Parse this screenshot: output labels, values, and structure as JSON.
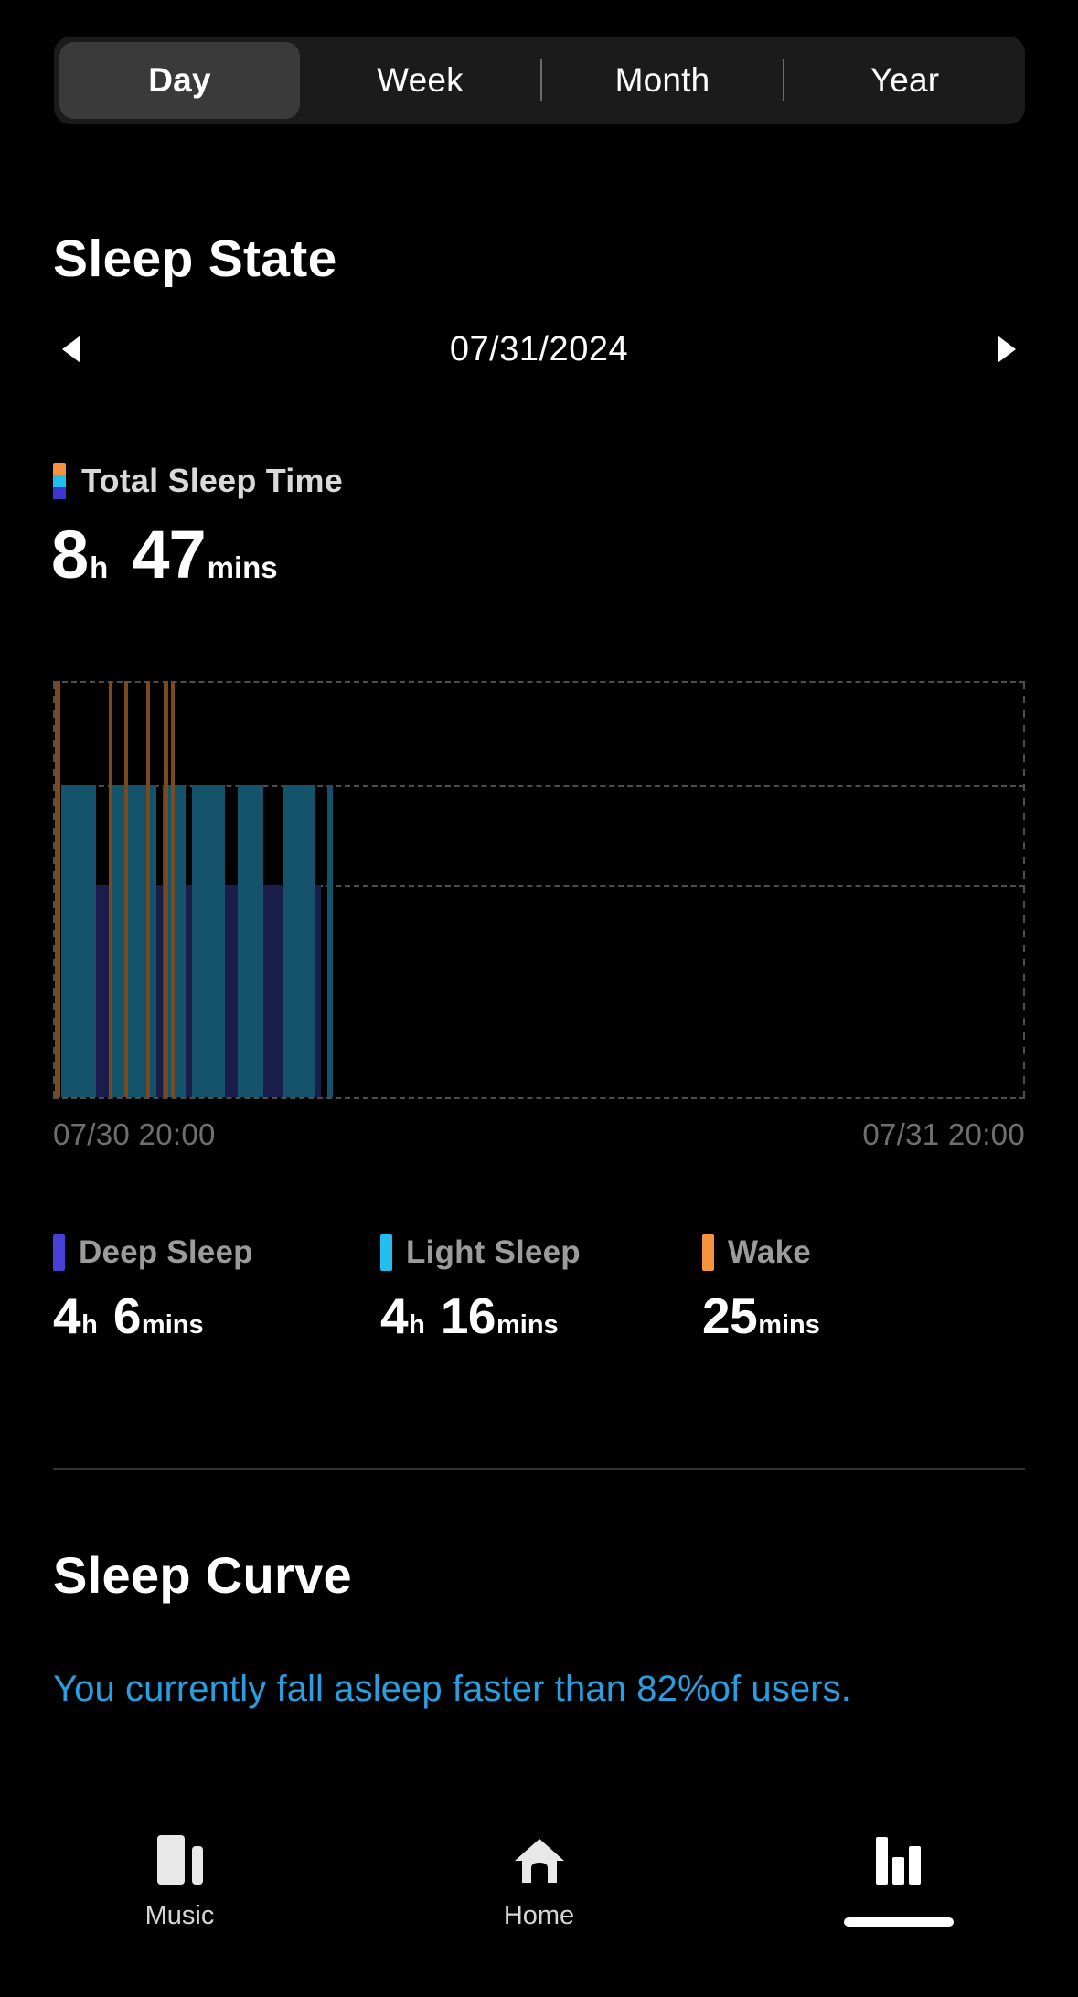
{
  "period_tabs": {
    "items": [
      {
        "label": "Day",
        "active": true
      },
      {
        "label": "Week",
        "active": false
      },
      {
        "label": "Month",
        "active": false
      },
      {
        "label": "Year",
        "active": false
      }
    ]
  },
  "page_title": "Sleep State",
  "date_nav": {
    "prev_icon": "triangle-left-icon",
    "next_icon": "triangle-right-icon",
    "date": "07/31/2024"
  },
  "total_sleep": {
    "label": "Total Sleep Time",
    "hours": "8",
    "hours_unit": "h",
    "minutes": "47",
    "minutes_unit": "mins",
    "swatch_colors": [
      "#F5933F",
      "#22BEF0",
      "#3C35CE"
    ]
  },
  "chart_axis": {
    "start": "07/30 20:00",
    "end": "07/31 20:00"
  },
  "legend": [
    {
      "name": "Deep Sleep",
      "color": "#4940d6",
      "hours": "4",
      "hours_unit": "h",
      "minutes": "6",
      "minutes_unit": "mins"
    },
    {
      "name": "Light Sleep",
      "color": "#22BEF0",
      "hours": "4",
      "hours_unit": "h",
      "minutes": "16",
      "minutes_unit": "mins"
    },
    {
      "name": "Wake",
      "color": "#F5933F",
      "hours": "",
      "hours_unit": "",
      "minutes": "25",
      "minutes_unit": "mins"
    }
  ],
  "sleep_curve": {
    "title": "Sleep Curve",
    "description": "You currently fall asleep faster than 82%of users."
  },
  "bottom_nav": {
    "items": [
      {
        "label": "Music",
        "icon": "music-library-icon"
      },
      {
        "label": "Home",
        "icon": "home-icon"
      },
      {
        "label": "",
        "icon": "bar-chart-icon"
      }
    ]
  },
  "chart_data": {
    "type": "bar",
    "title": "Sleep State hypnogram",
    "xlabel": "",
    "ylabel": "",
    "grid": true,
    "legend_position": "below",
    "x_axis": {
      "start": "07/30 20:00",
      "end": "07/31 20:00",
      "total_hours": 24
    },
    "categories": [
      "Wake",
      "Light Sleep",
      "Deep Sleep"
    ],
    "band_colors": {
      "Wake": "#7a4a1e",
      "Light Sleep": "#15536a",
      "Deep Sleep": "#1a1d4a"
    },
    "bands": [
      {
        "name": "Wake",
        "top_pct": 0,
        "height_pct": 25
      },
      {
        "name": "Light Sleep",
        "top_pct": 25,
        "height_pct": 24
      },
      {
        "name": "Deep Sleep",
        "top_pct": 49,
        "height_pct": 51
      }
    ],
    "series": [
      {
        "name": "Wake",
        "color": "#7a4a1e",
        "top_pct": 0,
        "height_pct": 100,
        "segments": [
          {
            "start_pct": 0.2,
            "width_pct": 0.55
          },
          {
            "start_pct": 5.7,
            "width_pct": 0.45
          },
          {
            "start_pct": 7.3,
            "width_pct": 0.45
          },
          {
            "start_pct": 9.6,
            "width_pct": 0.4
          },
          {
            "start_pct": 11.4,
            "width_pct": 0.45
          },
          {
            "start_pct": 12.1,
            "width_pct": 0.4
          }
        ]
      },
      {
        "name": "Light Sleep",
        "color": "#15536a",
        "top_pct": 25,
        "height_pct": 75,
        "segments": [
          {
            "start_pct": 0.8,
            "width_pct": 3.6
          },
          {
            "start_pct": 6.0,
            "width_pct": 4.6
          },
          {
            "start_pct": 11.3,
            "width_pct": 0.8
          },
          {
            "start_pct": 12.5,
            "width_pct": 1.1
          },
          {
            "start_pct": 14.3,
            "width_pct": 3.4
          },
          {
            "start_pct": 19.0,
            "width_pct": 2.6
          },
          {
            "start_pct": 23.6,
            "width_pct": 3.4
          },
          {
            "start_pct": 28.2,
            "width_pct": 0.6
          }
        ]
      },
      {
        "name": "Deep Sleep",
        "color": "#1a1d4a",
        "top_pct": 49,
        "height_pct": 51,
        "segments": [
          {
            "start_pct": 0.8,
            "width_pct": 26.8
          }
        ]
      }
    ]
  }
}
